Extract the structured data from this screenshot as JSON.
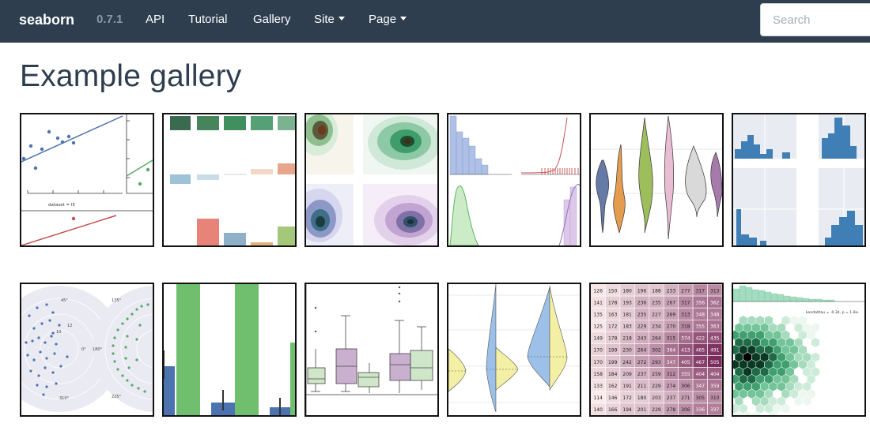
{
  "navbar": {
    "brand": "seaborn",
    "version": "0.7.1",
    "links": [
      "API",
      "Tutorial",
      "Gallery"
    ],
    "dropdowns": [
      "Site",
      "Page"
    ],
    "search_placeholder": "Search"
  },
  "page": {
    "title": "Example gallery"
  },
  "gallery": {
    "thumb1_caption": "dataset = III",
    "thumb7_ticks": [
      "45°",
      "0°",
      "310°",
      "135°",
      "180°",
      "225°",
      "10",
      "12"
    ],
    "thumb12_annotation": "kendalltau = -0.34, p = 1.8e-",
    "heatmap_rows": [
      [
        "126",
        "150",
        "180",
        "196",
        "188",
        "233",
        "277",
        "317",
        "313"
      ],
      [
        "141",
        "178",
        "193",
        "236",
        "235",
        "267",
        "317",
        "356",
        "362"
      ],
      [
        "135",
        "163",
        "181",
        "235",
        "227",
        "269",
        "313",
        "348",
        "348"
      ],
      [
        "125",
        "172",
        "183",
        "229",
        "234",
        "270",
        "318",
        "355",
        "363"
      ],
      [
        "149",
        "178",
        "218",
        "243",
        "264",
        "315",
        "374",
        "422",
        "435"
      ],
      [
        "170",
        "199",
        "230",
        "264",
        "302",
        "364",
        "413",
        "465",
        "491"
      ],
      [
        "170",
        "199",
        "242",
        "272",
        "293",
        "347",
        "405",
        "467",
        "505"
      ],
      [
        "158",
        "184",
        "209",
        "237",
        "259",
        "312",
        "355",
        "404",
        "404"
      ],
      [
        "133",
        "162",
        "191",
        "211",
        "229",
        "274",
        "306",
        "347",
        "359"
      ],
      [
        "114",
        "146",
        "172",
        "180",
        "203",
        "237",
        "271",
        "305",
        "310"
      ],
      [
        "140",
        "166",
        "194",
        "201",
        "229",
        "278",
        "306",
        "336",
        "337"
      ]
    ]
  },
  "colors": {
    "navbar_bg": "#2e3e4f",
    "title": "#2e3e4f",
    "version": "#8b96a1"
  }
}
